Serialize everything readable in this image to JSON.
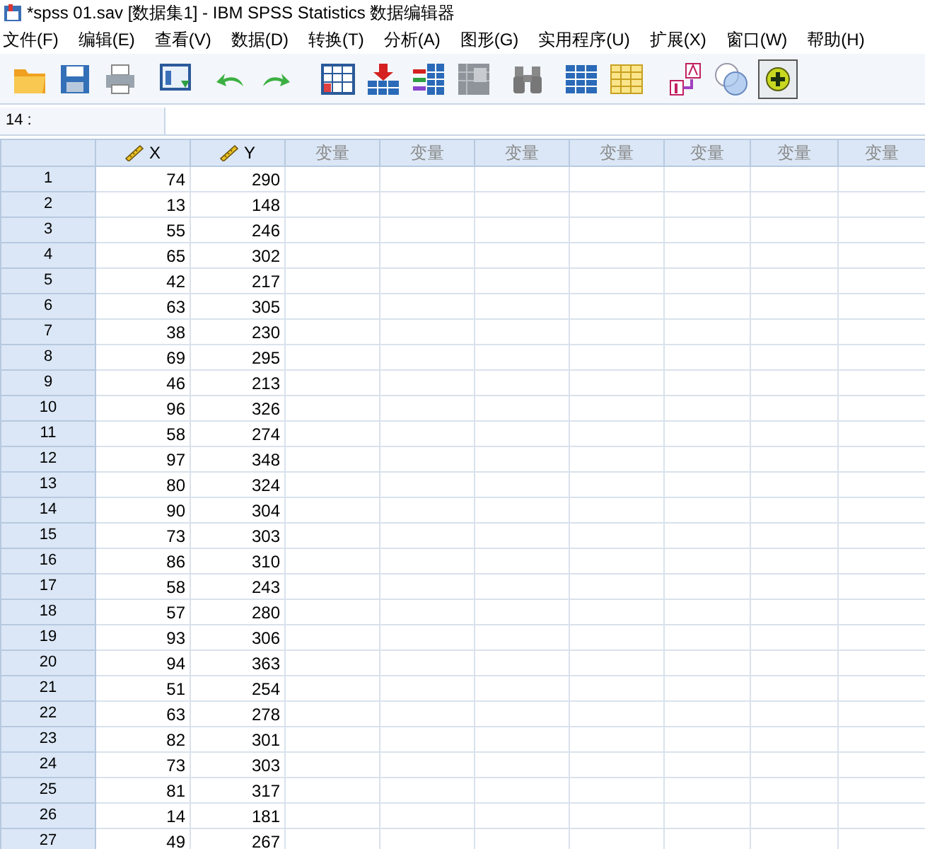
{
  "window": {
    "title": "*spss 01.sav [数据集1] - IBM SPSS Statistics 数据编辑器"
  },
  "menu": [
    "文件(F)",
    "编辑(E)",
    "查看(V)",
    "数据(D)",
    "转换(T)",
    "分析(A)",
    "图形(G)",
    "实用程序(U)",
    "扩展(X)",
    "窗口(W)",
    "帮助(H)"
  ],
  "cell_editor": {
    "cell_ref": "14 :"
  },
  "columns": [
    {
      "label": "X",
      "kind": "variable"
    },
    {
      "label": "Y",
      "kind": "variable"
    },
    {
      "label": "变量",
      "kind": "empty"
    },
    {
      "label": "变量",
      "kind": "empty"
    },
    {
      "label": "变量",
      "kind": "empty"
    },
    {
      "label": "变量",
      "kind": "empty"
    },
    {
      "label": "变量",
      "kind": "empty"
    },
    {
      "label": "变量",
      "kind": "empty"
    },
    {
      "label": "变量",
      "kind": "empty"
    }
  ],
  "rows": [
    {
      "number": "1",
      "values": [
        "74",
        "290"
      ]
    },
    {
      "number": "2",
      "values": [
        "13",
        "148"
      ]
    },
    {
      "number": "3",
      "values": [
        "55",
        "246"
      ]
    },
    {
      "number": "4",
      "values": [
        "65",
        "302"
      ]
    },
    {
      "number": "5",
      "values": [
        "42",
        "217"
      ]
    },
    {
      "number": "6",
      "values": [
        "63",
        "305"
      ]
    },
    {
      "number": "7",
      "values": [
        "38",
        "230"
      ]
    },
    {
      "number": "8",
      "values": [
        "69",
        "295"
      ]
    },
    {
      "number": "9",
      "values": [
        "46",
        "213"
      ]
    },
    {
      "number": "10",
      "values": [
        "96",
        "326"
      ]
    },
    {
      "number": "11",
      "values": [
        "58",
        "274"
      ]
    },
    {
      "number": "12",
      "values": [
        "97",
        "348"
      ]
    },
    {
      "number": "13",
      "values": [
        "80",
        "324"
      ]
    },
    {
      "number": "14",
      "values": [
        "90",
        "304"
      ]
    },
    {
      "number": "15",
      "values": [
        "73",
        "303"
      ]
    },
    {
      "number": "16",
      "values": [
        "86",
        "310"
      ]
    },
    {
      "number": "17",
      "values": [
        "58",
        "243"
      ]
    },
    {
      "number": "18",
      "values": [
        "57",
        "280"
      ]
    },
    {
      "number": "19",
      "values": [
        "93",
        "306"
      ]
    },
    {
      "number": "20",
      "values": [
        "94",
        "363"
      ]
    },
    {
      "number": "21",
      "values": [
        "51",
        "254"
      ]
    },
    {
      "number": "22",
      "values": [
        "63",
        "278"
      ]
    },
    {
      "number": "23",
      "values": [
        "82",
        "301"
      ]
    },
    {
      "number": "24",
      "values": [
        "73",
        "303"
      ]
    },
    {
      "number": "25",
      "values": [
        "81",
        "317"
      ]
    },
    {
      "number": "26",
      "values": [
        "14",
        "181"
      ]
    },
    {
      "number": "27",
      "values": [
        "49",
        "267"
      ]
    }
  ]
}
